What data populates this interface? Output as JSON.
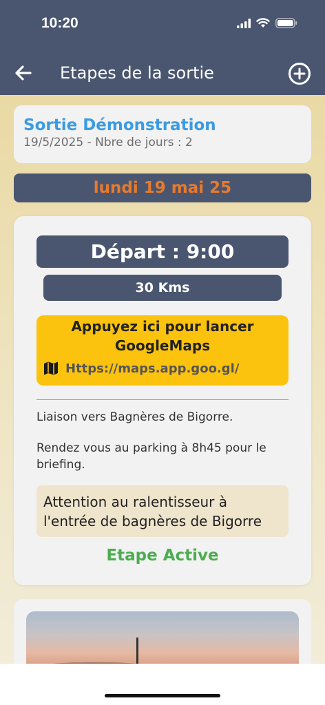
{
  "status": {
    "time": "10:20",
    "icons": [
      "signal-icon",
      "wifi-icon",
      "battery-icon"
    ]
  },
  "nav": {
    "title": "Etapes de la sortie",
    "back_icon": "back-arrow-icon",
    "add_icon": "add-circle-icon"
  },
  "trip": {
    "title": "Sortie Démonstration",
    "subtitle": "19/5/2025 - Nbre de jours : 2"
  },
  "day": {
    "label": "lundi 19 mai 25"
  },
  "step": {
    "depart": "Départ : 9:00",
    "distance": "30 Kms",
    "maps_title_line1": "Appuyez ici pour lancer",
    "maps_title_line2": "GoogleMaps",
    "maps_link": "Https://maps.app.goo.gl/",
    "description_1": "Liaison vers Bagnères de Bigorre.",
    "description_2": "Rendez vous au parking à 8h45 pour le briefing.",
    "warning_line1": "Attention au ralentisseur à",
    "warning_line2": "l'entrée de bagnères de Bigorre",
    "status": "Etape Active"
  },
  "colors": {
    "header": "#4a5670",
    "trip_title": "#3b9be2",
    "day_label": "#e87a2c",
    "maps_button": "#fcc30e",
    "active_status": "#4cad50",
    "warning_bg": "#efe4cc"
  }
}
